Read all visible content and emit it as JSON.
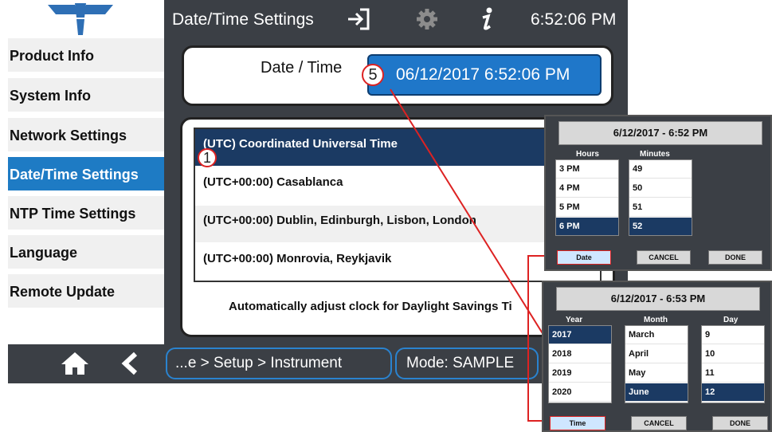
{
  "header": {
    "title": "Date/Time Settings",
    "clock": "6:52:06 PM",
    "icons": [
      "teledyne-logo",
      "exit-icon",
      "gear-icon",
      "info-icon"
    ]
  },
  "sidebar": {
    "items": [
      {
        "label": "Product Info"
      },
      {
        "label": "System Info"
      },
      {
        "label": "Network Settings"
      },
      {
        "label": "Date/Time Settings",
        "active": true
      },
      {
        "label": "NTP Time Settings"
      },
      {
        "label": "Language"
      },
      {
        "label": "Remote Update"
      }
    ]
  },
  "datetime": {
    "label": "Date / Time",
    "value": "06/12/2017 6:52:06 PM"
  },
  "timezones": {
    "items": [
      "(UTC) Coordinated Universal Time",
      "(UTC+00:00) Casablanca",
      "(UTC+00:00) Dublin, Edinburgh, Lisbon, London",
      "(UTC+00:00) Monrovia, Reykjavik"
    ],
    "selected_index": 0,
    "dst_label": "Automatically adjust clock for Daylight Savings Ti"
  },
  "footer": {
    "breadcrumb": "...e > Setup > Instrument",
    "mode": "Mode: SAMPLE"
  },
  "callouts": {
    "c5": "5",
    "c1": "1"
  },
  "time_dialog": {
    "title": "6/12/2017 - 6:52 PM",
    "hours_label": "Hours",
    "minutes_label": "Minutes",
    "hours": [
      "3 PM",
      "4 PM",
      "5 PM",
      "6 PM"
    ],
    "minutes": [
      "49",
      "50",
      "51",
      "52"
    ],
    "date_button": "Date",
    "cancel_button": "CANCEL",
    "done_button": "DONE"
  },
  "date_dialog": {
    "title": "6/12/2017 - 6:53 PM",
    "year_label": "Year",
    "month_label": "Month",
    "day_label": "Day",
    "years": [
      "2017",
      "2018",
      "2019",
      "2020"
    ],
    "months": [
      "March",
      "April",
      "May",
      "June"
    ],
    "days": [
      "9",
      "10",
      "11",
      "12"
    ],
    "time_button": "Time",
    "cancel_button": "CANCEL",
    "done_button": "DONE"
  },
  "colors": {
    "bar": "#3b3f45",
    "accent": "#1e7bc4",
    "selected": "#1b3a63",
    "callout": "#dd2222"
  }
}
